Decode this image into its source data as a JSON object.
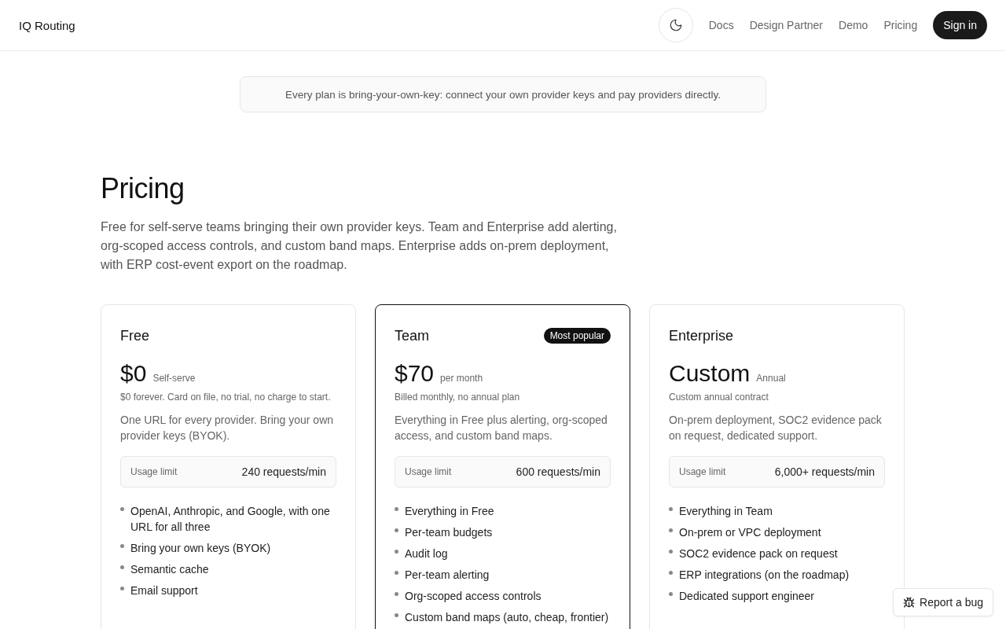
{
  "header": {
    "brand": "IQ Routing",
    "nav": [
      "Docs",
      "Design Partner",
      "Demo",
      "Pricing"
    ],
    "sign_in": "Sign in"
  },
  "notice": "Every plan is bring-your-own-key: connect your own provider keys and pay providers directly.",
  "title": "Pricing",
  "intro": "Free for self-serve teams bringing their own provider keys. Team and Enterprise add alerting, org-scoped access controls, and custom band maps. Enterprise adds on-prem deployment, with ERP cost-event export on the roadmap.",
  "plans": [
    {
      "name": "Free",
      "featured": false,
      "price": "$0",
      "period": "Self-serve",
      "billing": "$0 forever. Card on file, no trial, no charge to start.",
      "summary": "One URL for every provider. Bring your own provider keys (BYOK).",
      "limit_label": "Usage limit",
      "limit": "240 requests/min",
      "features": [
        "OpenAI, Anthropic, and Google, with one URL for all three",
        "Bring your own keys (BYOK)",
        "Semantic cache",
        "Email support"
      ]
    },
    {
      "name": "Team",
      "featured": true,
      "badge": "Most popular",
      "price": "$70",
      "period": "per month",
      "billing": "Billed monthly, no annual plan",
      "summary": "Everything in Free plus alerting, org-scoped access, and custom band maps.",
      "limit_label": "Usage limit",
      "limit": "600 requests/min",
      "features": [
        "Everything in Free",
        "Per-team budgets",
        "Audit log",
        "Per-team alerting",
        "Org-scoped access controls",
        "Custom band maps (auto, cheap, frontier)"
      ]
    },
    {
      "name": "Enterprise",
      "featured": false,
      "price": "Custom",
      "period": "Annual",
      "billing": "Custom annual contract",
      "summary": "On-prem deployment, SOC2 evidence pack on request, dedicated support.",
      "limit_label": "Usage limit",
      "limit": "6,000+ requests/min",
      "features": [
        "Everything in Team",
        "On-prem or VPC deployment",
        "SOC2 evidence pack on request",
        "ERP integrations (on the roadmap)",
        "Dedicated support engineer"
      ]
    }
  ],
  "report_bug": "Report a bug"
}
